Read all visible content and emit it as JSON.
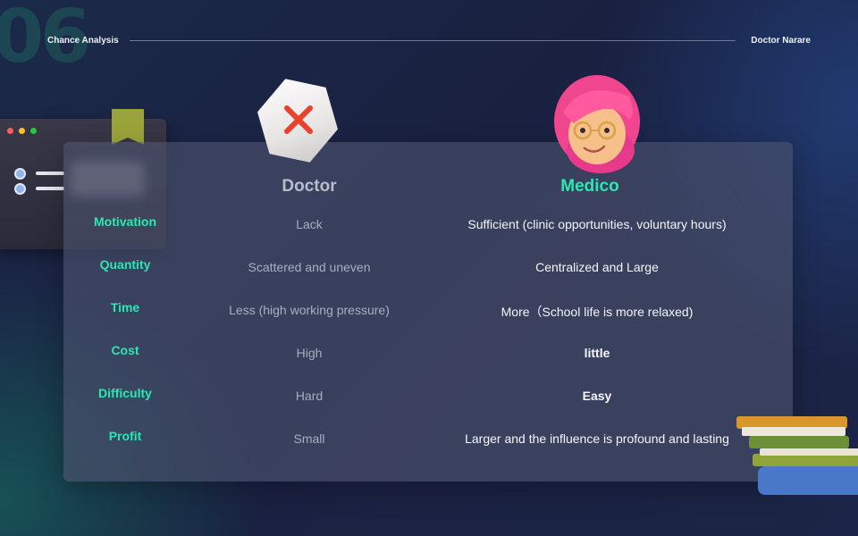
{
  "header": {
    "section_number": "06",
    "left_title": "Chance Analysis",
    "right_title": "Doctor Narare"
  },
  "columns": {
    "doctor": "Doctor",
    "medico": "Medico"
  },
  "rows": [
    {
      "label": "Motivation",
      "doctor": "Lack",
      "medico": "Sufficient (clinic opportunities, voluntary hours)",
      "medico_bold": false
    },
    {
      "label": "Quantity",
      "doctor": "Scattered and uneven",
      "medico": "Centralized and Large",
      "medico_bold": false
    },
    {
      "label": "Time",
      "doctor": "Less (high working pressure)",
      "medico": "More（School life is more relaxed)",
      "medico_bold": false
    },
    {
      "label": "Cost",
      "doctor": "High",
      "medico": "little",
      "medico_bold": true
    },
    {
      "label": "Difficulty",
      "doctor": "Hard",
      "medico": "Easy",
      "medico_bold": true
    },
    {
      "label": "Profit",
      "doctor": "Small",
      "medico": "Larger and the influence is profound and lasting",
      "medico_bold": false
    }
  ],
  "colors": {
    "accent": "#2ee6b4",
    "x_mark": "#e8412c"
  },
  "icons": {
    "doctor": "x-mark-hexagon-icon",
    "medico": "pink-hair-avatar-icon"
  }
}
